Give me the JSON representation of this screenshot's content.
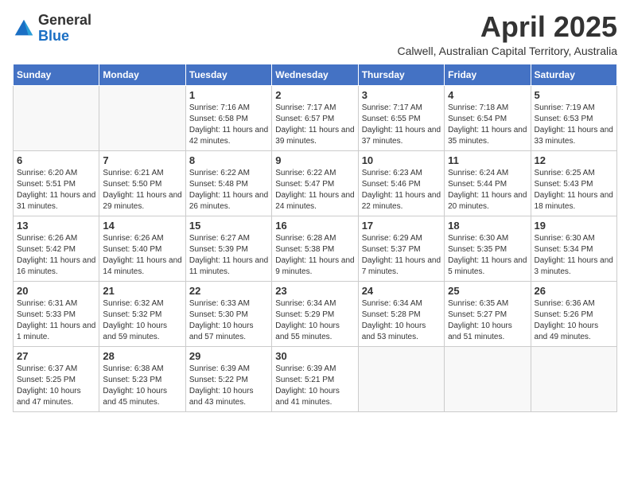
{
  "header": {
    "logo_general": "General",
    "logo_blue": "Blue",
    "month_year": "April 2025",
    "location": "Calwell, Australian Capital Territory, Australia"
  },
  "weekdays": [
    "Sunday",
    "Monday",
    "Tuesday",
    "Wednesday",
    "Thursday",
    "Friday",
    "Saturday"
  ],
  "weeks": [
    [
      {
        "day": "",
        "sunrise": "",
        "sunset": "",
        "daylight": ""
      },
      {
        "day": "",
        "sunrise": "",
        "sunset": "",
        "daylight": ""
      },
      {
        "day": "1",
        "sunrise": "Sunrise: 7:16 AM",
        "sunset": "Sunset: 6:58 PM",
        "daylight": "Daylight: 11 hours and 42 minutes."
      },
      {
        "day": "2",
        "sunrise": "Sunrise: 7:17 AM",
        "sunset": "Sunset: 6:57 PM",
        "daylight": "Daylight: 11 hours and 39 minutes."
      },
      {
        "day": "3",
        "sunrise": "Sunrise: 7:17 AM",
        "sunset": "Sunset: 6:55 PM",
        "daylight": "Daylight: 11 hours and 37 minutes."
      },
      {
        "day": "4",
        "sunrise": "Sunrise: 7:18 AM",
        "sunset": "Sunset: 6:54 PM",
        "daylight": "Daylight: 11 hours and 35 minutes."
      },
      {
        "day": "5",
        "sunrise": "Sunrise: 7:19 AM",
        "sunset": "Sunset: 6:53 PM",
        "daylight": "Daylight: 11 hours and 33 minutes."
      }
    ],
    [
      {
        "day": "6",
        "sunrise": "Sunrise: 6:20 AM",
        "sunset": "Sunset: 5:51 PM",
        "daylight": "Daylight: 11 hours and 31 minutes."
      },
      {
        "day": "7",
        "sunrise": "Sunrise: 6:21 AM",
        "sunset": "Sunset: 5:50 PM",
        "daylight": "Daylight: 11 hours and 29 minutes."
      },
      {
        "day": "8",
        "sunrise": "Sunrise: 6:22 AM",
        "sunset": "Sunset: 5:48 PM",
        "daylight": "Daylight: 11 hours and 26 minutes."
      },
      {
        "day": "9",
        "sunrise": "Sunrise: 6:22 AM",
        "sunset": "Sunset: 5:47 PM",
        "daylight": "Daylight: 11 hours and 24 minutes."
      },
      {
        "day": "10",
        "sunrise": "Sunrise: 6:23 AM",
        "sunset": "Sunset: 5:46 PM",
        "daylight": "Daylight: 11 hours and 22 minutes."
      },
      {
        "day": "11",
        "sunrise": "Sunrise: 6:24 AM",
        "sunset": "Sunset: 5:44 PM",
        "daylight": "Daylight: 11 hours and 20 minutes."
      },
      {
        "day": "12",
        "sunrise": "Sunrise: 6:25 AM",
        "sunset": "Sunset: 5:43 PM",
        "daylight": "Daylight: 11 hours and 18 minutes."
      }
    ],
    [
      {
        "day": "13",
        "sunrise": "Sunrise: 6:26 AM",
        "sunset": "Sunset: 5:42 PM",
        "daylight": "Daylight: 11 hours and 16 minutes."
      },
      {
        "day": "14",
        "sunrise": "Sunrise: 6:26 AM",
        "sunset": "Sunset: 5:40 PM",
        "daylight": "Daylight: 11 hours and 14 minutes."
      },
      {
        "day": "15",
        "sunrise": "Sunrise: 6:27 AM",
        "sunset": "Sunset: 5:39 PM",
        "daylight": "Daylight: 11 hours and 11 minutes."
      },
      {
        "day": "16",
        "sunrise": "Sunrise: 6:28 AM",
        "sunset": "Sunset: 5:38 PM",
        "daylight": "Daylight: 11 hours and 9 minutes."
      },
      {
        "day": "17",
        "sunrise": "Sunrise: 6:29 AM",
        "sunset": "Sunset: 5:37 PM",
        "daylight": "Daylight: 11 hours and 7 minutes."
      },
      {
        "day": "18",
        "sunrise": "Sunrise: 6:30 AM",
        "sunset": "Sunset: 5:35 PM",
        "daylight": "Daylight: 11 hours and 5 minutes."
      },
      {
        "day": "19",
        "sunrise": "Sunrise: 6:30 AM",
        "sunset": "Sunset: 5:34 PM",
        "daylight": "Daylight: 11 hours and 3 minutes."
      }
    ],
    [
      {
        "day": "20",
        "sunrise": "Sunrise: 6:31 AM",
        "sunset": "Sunset: 5:33 PM",
        "daylight": "Daylight: 11 hours and 1 minute."
      },
      {
        "day": "21",
        "sunrise": "Sunrise: 6:32 AM",
        "sunset": "Sunset: 5:32 PM",
        "daylight": "Daylight: 10 hours and 59 minutes."
      },
      {
        "day": "22",
        "sunrise": "Sunrise: 6:33 AM",
        "sunset": "Sunset: 5:30 PM",
        "daylight": "Daylight: 10 hours and 57 minutes."
      },
      {
        "day": "23",
        "sunrise": "Sunrise: 6:34 AM",
        "sunset": "Sunset: 5:29 PM",
        "daylight": "Daylight: 10 hours and 55 minutes."
      },
      {
        "day": "24",
        "sunrise": "Sunrise: 6:34 AM",
        "sunset": "Sunset: 5:28 PM",
        "daylight": "Daylight: 10 hours and 53 minutes."
      },
      {
        "day": "25",
        "sunrise": "Sunrise: 6:35 AM",
        "sunset": "Sunset: 5:27 PM",
        "daylight": "Daylight: 10 hours and 51 minutes."
      },
      {
        "day": "26",
        "sunrise": "Sunrise: 6:36 AM",
        "sunset": "Sunset: 5:26 PM",
        "daylight": "Daylight: 10 hours and 49 minutes."
      }
    ],
    [
      {
        "day": "27",
        "sunrise": "Sunrise: 6:37 AM",
        "sunset": "Sunset: 5:25 PM",
        "daylight": "Daylight: 10 hours and 47 minutes."
      },
      {
        "day": "28",
        "sunrise": "Sunrise: 6:38 AM",
        "sunset": "Sunset: 5:23 PM",
        "daylight": "Daylight: 10 hours and 45 minutes."
      },
      {
        "day": "29",
        "sunrise": "Sunrise: 6:39 AM",
        "sunset": "Sunset: 5:22 PM",
        "daylight": "Daylight: 10 hours and 43 minutes."
      },
      {
        "day": "30",
        "sunrise": "Sunrise: 6:39 AM",
        "sunset": "Sunset: 5:21 PM",
        "daylight": "Daylight: 10 hours and 41 minutes."
      },
      {
        "day": "",
        "sunrise": "",
        "sunset": "",
        "daylight": ""
      },
      {
        "day": "",
        "sunrise": "",
        "sunset": "",
        "daylight": ""
      },
      {
        "day": "",
        "sunrise": "",
        "sunset": "",
        "daylight": ""
      }
    ]
  ]
}
